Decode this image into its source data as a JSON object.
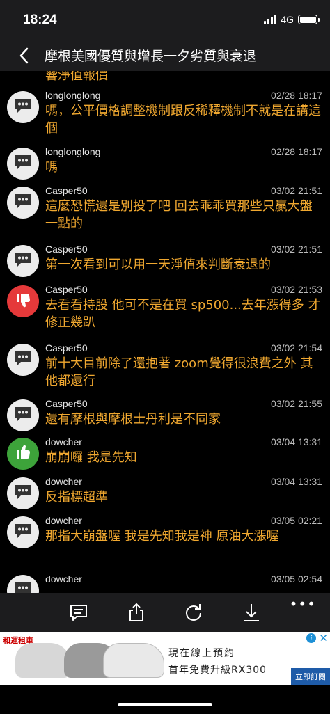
{
  "status": {
    "time": "18:24",
    "network": "4G"
  },
  "nav": {
    "title": "摩根美國優質與增長一夕劣質與衰退"
  },
  "partial_message": "響淨值報價",
  "messages": [
    {
      "user": "longlonglong",
      "time": "02/28 18:17",
      "text": "嗎，公平價格調整機制跟反稀釋機制不就是在講這個",
      "avatar": "comment"
    },
    {
      "user": "longlonglong",
      "time": "02/28 18:17",
      "text": "嗎",
      "avatar": "comment"
    },
    {
      "user": "Casper50",
      "time": "03/02 21:51",
      "text": "這麼恐慌還是別投了吧 回去乖乖買那些只贏大盤一點的",
      "avatar": "comment"
    },
    {
      "user": "Casper50",
      "time": "03/02 21:51",
      "text": "第一次看到可以用一天淨值來判斷衰退的",
      "avatar": "comment"
    },
    {
      "user": "Casper50",
      "time": "03/02 21:53",
      "text": "去看看持股 他可不是在買 sp500...去年漲得多 才修正幾趴",
      "avatar": "thumbs-down"
    },
    {
      "user": "Casper50",
      "time": "03/02 21:54",
      "text": "前十大目前除了還抱著 zoom覺得很浪費之外 其他都還行",
      "avatar": "comment"
    },
    {
      "user": "Casper50",
      "time": "03/02 21:55",
      "text": "還有摩根與摩根士丹利是不同家",
      "avatar": "comment"
    },
    {
      "user": "dowcher",
      "time": "03/04 13:31",
      "text": "崩崩囉 我是先知",
      "avatar": "thumbs-up"
    },
    {
      "user": "dowcher",
      "time": "03/04 13:31",
      "text": "反指標超準",
      "avatar": "comment"
    },
    {
      "user": "dowcher",
      "time": "03/05 02:21",
      "text": "那指大崩盤喔 我是先知我是神 原油大漲喔",
      "avatar": "comment"
    },
    {
      "user": "dowcher",
      "time": "03/05 02:54",
      "text": "",
      "avatar": "comment"
    }
  ],
  "toolbar": {
    "more": "•••"
  },
  "ad": {
    "brand": "和運租車",
    "line1": "現在線上預約",
    "line2": "首年免費升級RX300",
    "cta": "立即訂閱",
    "info": "i",
    "close": "✕"
  },
  "colors": {
    "accent": "#f0a830",
    "background": "#000000",
    "bar": "#1c1c1e"
  }
}
